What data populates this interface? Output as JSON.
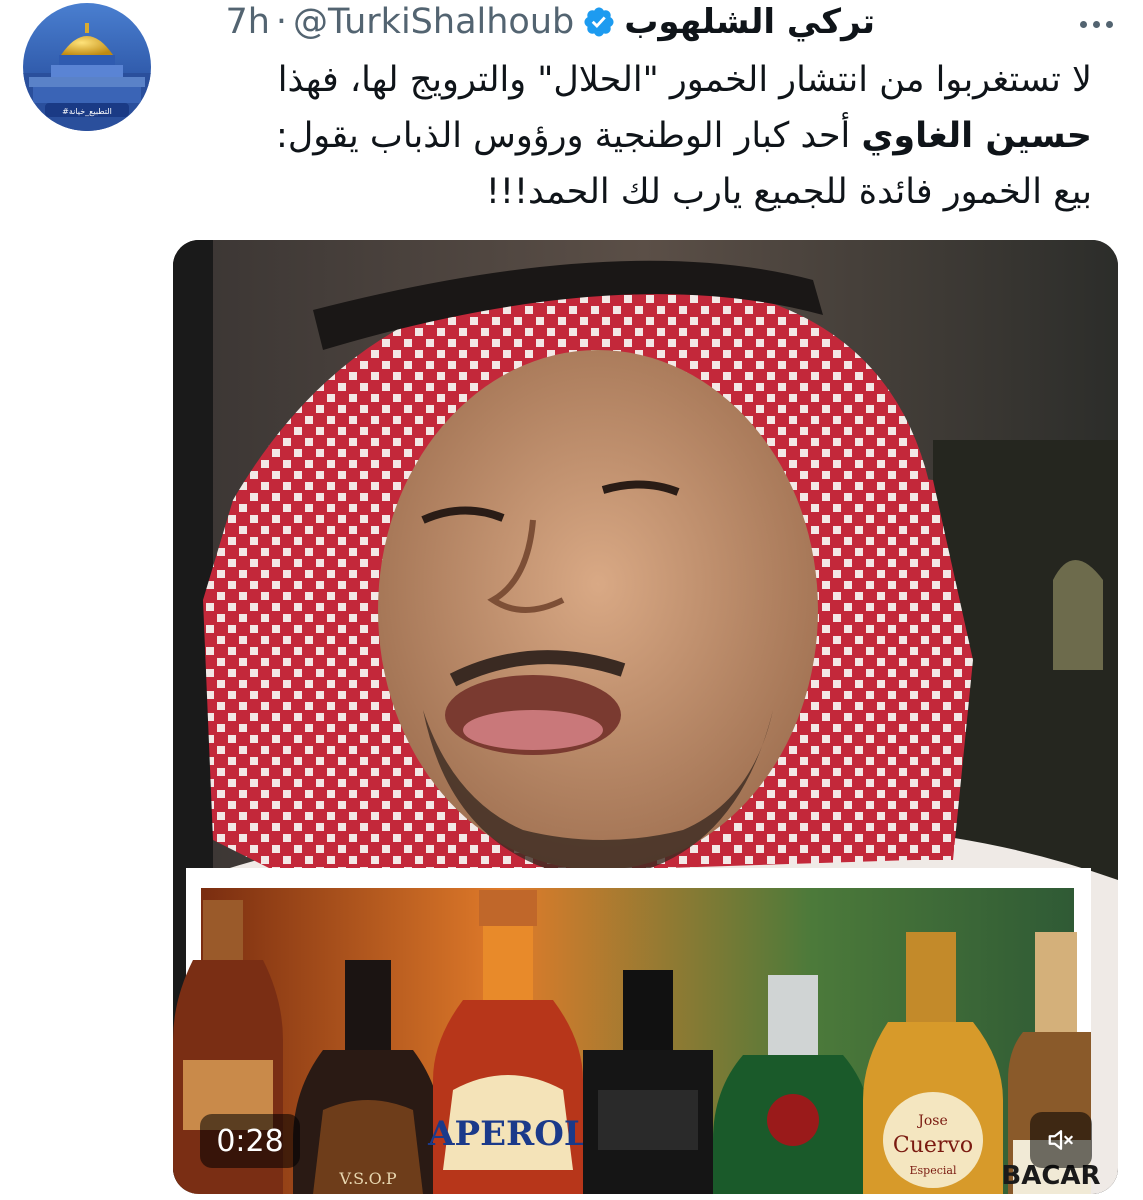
{
  "author": {
    "display_name": "تركي الشلهوب",
    "handle": "@TurkiShalhoub",
    "separator": "·",
    "time": "7h",
    "verified_icon": "verified-badge-icon",
    "avatar_icon": "avatar-dome-icon",
    "avatar_banner": "#التطبيع_خيانة",
    "colors": {
      "verified": "#1d9bf0"
    }
  },
  "tweet": {
    "line1": "لا تستغربوا من انتشار الخمور \"الحلال\" والترويج لها، فهذا",
    "line2_bold": "حسين الغاوي",
    "line2_rest": " أحد كبار الوطنجية ورؤوس الذباب يقول:",
    "line3": "بيع الخمور فائدة للجميع يارب لك الحمد!!!"
  },
  "media": {
    "type": "video",
    "duration": "0:28",
    "more_icon": "more-dots-icon",
    "mute_icon": "speaker-muted-icon",
    "bottle_labels": {
      "aperol": "APEROL",
      "vsop": "V.S.O.P",
      "cuervo_1": "Jose",
      "cuervo_2": "Cuervo",
      "cuervo_3": "Especial",
      "bacardi": "BACAR"
    }
  }
}
